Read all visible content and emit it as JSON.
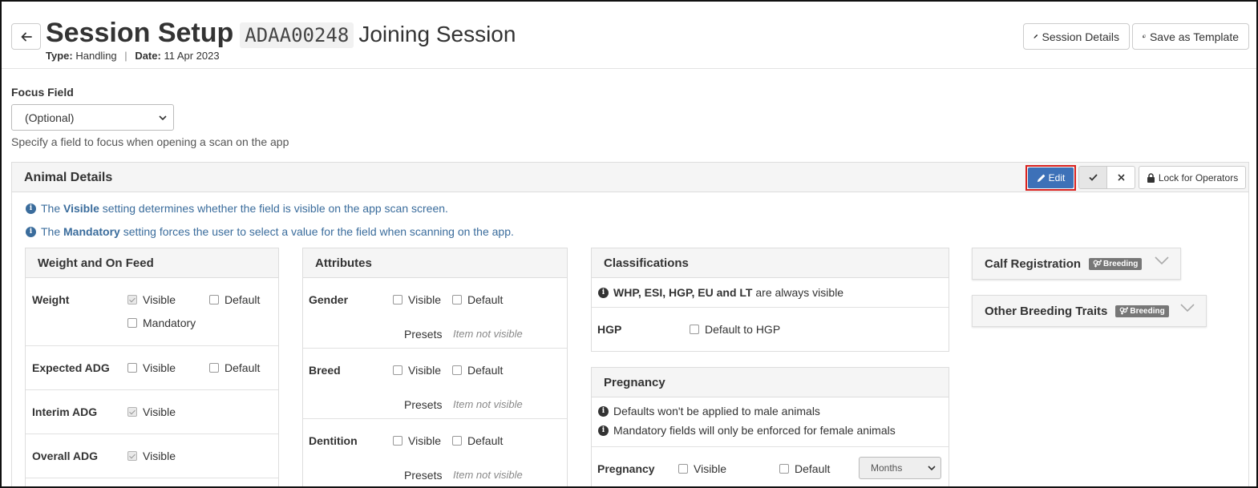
{
  "header": {
    "title": "Session Setup",
    "code": "ADAA00248",
    "subtitle": "Joining Session",
    "type_label": "Type:",
    "type_value": "Handling",
    "separator": "|",
    "date_label": "Date:",
    "date_value": "11 Apr 2023",
    "session_details_label": "Session Details",
    "save_template_label": "Save as Template"
  },
  "focus": {
    "label": "Focus Field",
    "value": "(Optional)",
    "help": "Specify a field to focus when opening a scan on the app"
  },
  "animal_details": {
    "title": "Animal Details",
    "edit_label": "Edit",
    "lock_label": "Lock for Operators",
    "info_visible": {
      "pre": "The",
      "keyword": "Visible",
      "post": "setting determines whether the field is visible on the app scan screen."
    },
    "info_mandatory": {
      "pre": "The",
      "keyword": "Mandatory",
      "post": "setting forces the user to select a value for the field when scanning on the app."
    }
  },
  "weight_card": {
    "title": "Weight and On Feed",
    "rows": [
      {
        "label": "Weight",
        "visible": "Visible",
        "default": "Default",
        "mandatory": "Mandatory"
      },
      {
        "label": "Expected ADG",
        "visible": "Visible",
        "default": "Default"
      },
      {
        "label": "Interim ADG",
        "visible": "Visible"
      },
      {
        "label": "Overall ADG",
        "visible": "Visible"
      }
    ]
  },
  "attributes_card": {
    "title": "Attributes",
    "rows": [
      {
        "label": "Gender",
        "visible": "Visible",
        "default": "Default",
        "presets": "Presets",
        "presets_value": "Item not visible"
      },
      {
        "label": "Breed",
        "visible": "Visible",
        "default": "Default",
        "presets": "Presets",
        "presets_value": "Item not visible"
      },
      {
        "label": "Dentition",
        "visible": "Visible",
        "default": "Default",
        "presets": "Presets",
        "presets_value": "Item not visible"
      }
    ]
  },
  "classifications_card": {
    "title": "Classifications",
    "note_bold": "WHP, ESI, HGP, EU and LT",
    "note_rest": "are always visible",
    "hgp_label": "HGP",
    "hgp_default": "Default to HGP"
  },
  "pregnancy_card": {
    "title": "Pregnancy",
    "note1": "Defaults won't be applied to male animals",
    "note2": "Mandatory fields will only be enforced for female animals",
    "row_label": "Pregnancy",
    "visible": "Visible",
    "default": "Default",
    "unit": "Months"
  },
  "calf_card": {
    "title": "Calf Registration",
    "badge": "Breeding"
  },
  "other_card": {
    "title": "Other Breeding Traits",
    "badge": "Breeding"
  }
}
